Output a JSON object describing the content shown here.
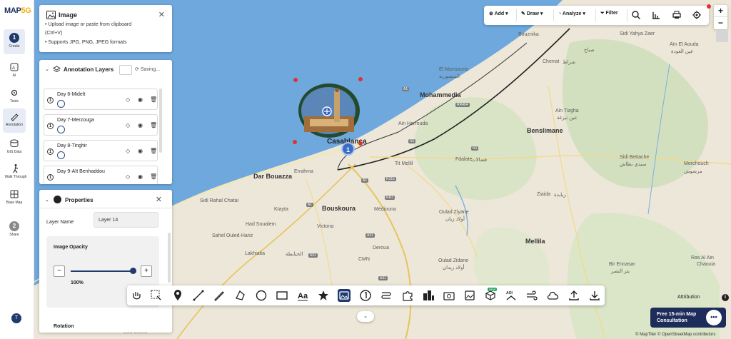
{
  "app": {
    "logo_main": "MAP",
    "logo_accent": "5G"
  },
  "rail": {
    "create_step": "1",
    "create_label": "Create",
    "ai_label": "AI",
    "tools_label": "Tools",
    "annotation_label": "Annotation",
    "gis_label": "GIS Data",
    "walk_label": "Walk Through",
    "basemap_label": "Base Map",
    "share_step": "2",
    "share_label": "Share",
    "avatar_initial": "T"
  },
  "image_panel": {
    "title": "Image",
    "close": "✕",
    "lines": [
      "• Upload image or paste from clipboard",
      "(Ctrl+V)",
      "• Supports JPG, PNG, JPEG formats"
    ]
  },
  "layers_panel": {
    "title": "Annotation Layers",
    "status": "Saving...",
    "rows": [
      {
        "num": "1",
        "name": "Day 6-Midelt"
      },
      {
        "num": "1",
        "name": "Day 7-Merzouga"
      },
      {
        "num": "1",
        "name": "Day 8-Tinghir"
      },
      {
        "num": "1",
        "name": "Day 9-Aït Benhaddou"
      }
    ]
  },
  "properties_panel": {
    "title": "Properties",
    "close": "✕",
    "layer_name_label": "Layer Name",
    "layer_name_value": "Layer 14",
    "opacity_title": "Image Opacity",
    "minus": "−",
    "plus": "+",
    "opacity_value": "100%",
    "opacity_fraction": 1.0,
    "rotation_label": "Rotation"
  },
  "toolbar": {
    "add": "Add",
    "draw": "Draw",
    "analyze": "Analyze",
    "filter": "Filter"
  },
  "zoom": {
    "plus": "+",
    "minus": "−"
  },
  "map_labels": [
    {
      "text": "Casablanca",
      "cls": "big"
    },
    {
      "text": "Mohammedia",
      "cls": "city"
    },
    {
      "text": "Ain Harrouda",
      "cls": ""
    },
    {
      "text": "Sidi Yahya Zaer",
      "cls": ""
    },
    {
      "text": "Bouznika",
      "cls": ""
    },
    {
      "text": "صباح",
      "cls": ""
    },
    {
      "text": "Cherrat",
      "cls": ""
    },
    {
      "text": "شراط",
      "cls": ""
    },
    {
      "text": "El Mansouria",
      "cls": ""
    },
    {
      "text": "المنصورية",
      "cls": ""
    },
    {
      "text": "Ain Tizgha",
      "cls": ""
    },
    {
      "text": "عين تيزغة",
      "cls": ""
    },
    {
      "text": "Benslimane",
      "cls": "city"
    },
    {
      "text": "Aïn El Aouda",
      "cls": ""
    },
    {
      "text": "عين العودة",
      "cls": ""
    },
    {
      "text": "Tit Mellil",
      "cls": ""
    },
    {
      "text": "Fdalate",
      "cls": ""
    },
    {
      "text": "فضالات",
      "cls": ""
    },
    {
      "text": "Sidi Bettache",
      "cls": ""
    },
    {
      "text": "سيدي بطاش",
      "cls": ""
    },
    {
      "text": "Merchouch",
      "cls": ""
    },
    {
      "text": "مرشوش",
      "cls": ""
    },
    {
      "text": "Dar Bouazza",
      "cls": "city"
    },
    {
      "text": "Errahma",
      "cls": ""
    },
    {
      "text": "Ziaida",
      "cls": ""
    },
    {
      "text": "زيايدة",
      "cls": ""
    },
    {
      "text": "Sidi Rahal Chatai",
      "cls": ""
    },
    {
      "text": "Ktayta",
      "cls": ""
    },
    {
      "text": "Bouskoura",
      "cls": "city"
    },
    {
      "text": "Médiouna",
      "cls": ""
    },
    {
      "text": "Oulad Ziyane",
      "cls": ""
    },
    {
      "text": "أولاد زيان",
      "cls": ""
    },
    {
      "text": "Had Soualem",
      "cls": ""
    },
    {
      "text": "Victoria",
      "cls": ""
    },
    {
      "text": "Sahel Ouled-Hariz",
      "cls": ""
    },
    {
      "text": "Mellila",
      "cls": "city"
    },
    {
      "text": "Deroua",
      "cls": ""
    },
    {
      "text": "Lakhiaita",
      "cls": ""
    },
    {
      "text": "الخيايطة",
      "cls": ""
    },
    {
      "text": "Oulad Zidane",
      "cls": ""
    },
    {
      "text": "أولاد زيدان",
      "cls": ""
    },
    {
      "text": "CMN",
      "cls": ""
    },
    {
      "text": "Bir Ennasar",
      "cls": ""
    },
    {
      "text": "بئر النصر",
      "cls": ""
    },
    {
      "text": "Ras Al Ain",
      "cls": ""
    },
    {
      "text": "Chaouia",
      "cls": ""
    },
    {
      "text": "Bou Sedra",
      "cls": ""
    }
  ],
  "road_badges": [
    "A1",
    "RR404",
    "N1",
    "A1",
    "A1",
    "RR3",
    "R315",
    "N1",
    "A31",
    "N11",
    "A31"
  ],
  "marker": {
    "cluster_count": "1"
  },
  "attribution": {
    "label": "Attribution",
    "info": "i"
  },
  "consult": {
    "line1": "Free 15-min Map",
    "line2": "Consultation",
    "chat": "•••"
  },
  "copyright": "© MapTiler © OpenStreetMap contributors",
  "bottom_toolbar": {
    "new_badge": "NEW",
    "text_tool": "Aa",
    "ai_badge": "AOI",
    "collapse": "⌄"
  },
  "colors": {
    "brand_navy": "#1e3a6e",
    "sea": "#6ea8dd",
    "land": "#ece7d8",
    "marker_ring": "#244a2e",
    "accent_red": "#e03030"
  }
}
